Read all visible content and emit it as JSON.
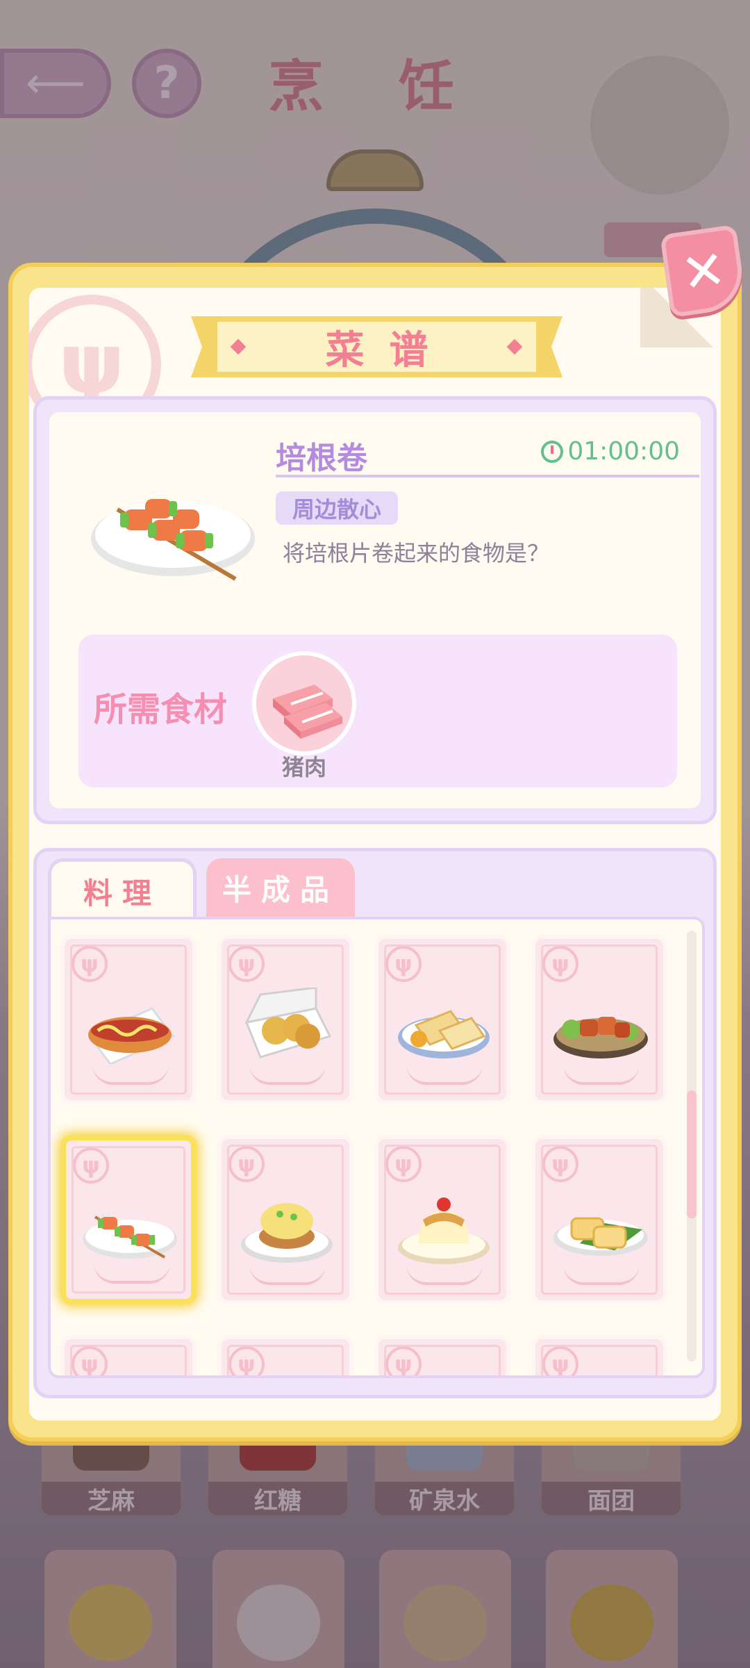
{
  "background": {
    "title": "烹 饪",
    "back_icon": "arrow-left-icon",
    "help_label": "?",
    "ingredients": [
      {
        "label": "芝麻"
      },
      {
        "label": "红糖"
      },
      {
        "label": "矿泉水"
      },
      {
        "label": "面团"
      }
    ]
  },
  "modal": {
    "title": "菜谱",
    "close_label": "✕",
    "dish": {
      "name": "培根卷",
      "time": "01:00:00",
      "tag": "周边散心",
      "description": "将培根片卷起来的食物是？"
    },
    "ingredients_label": "所需食材",
    "ingredients": [
      {
        "name": "猪肉",
        "icon": "pork-icon"
      }
    ],
    "tabs": [
      {
        "label": "料理",
        "active": true
      },
      {
        "label": "半成品",
        "active": false
      }
    ],
    "recipes": [
      {
        "icon": "hotdog-icon",
        "selected": false
      },
      {
        "icon": "bun-box-icon",
        "selected": false
      },
      {
        "icon": "sandwich-icon",
        "selected": false
      },
      {
        "icon": "glazed-meat-icon",
        "selected": false
      },
      {
        "icon": "bacon-roll-icon",
        "selected": true
      },
      {
        "icon": "eggs-benedict-icon",
        "selected": false
      },
      {
        "icon": "pudding-icon",
        "selected": false
      },
      {
        "icon": "tamagoyaki-icon",
        "selected": false
      }
    ]
  }
}
